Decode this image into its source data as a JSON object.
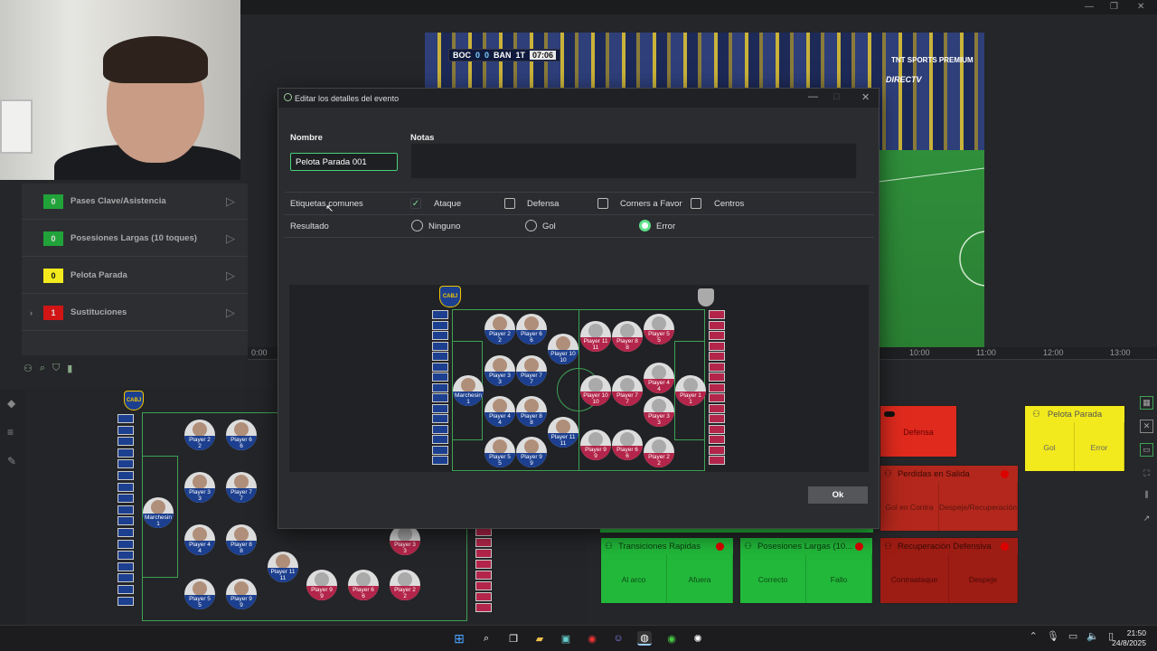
{
  "video": {
    "home_team": "BOC",
    "home_score": "0",
    "away_score": "0",
    "away_team": "BAN",
    "period": "1T",
    "clock": "07:06",
    "network": "TNT SPORTS PREMIUM",
    "sponsor": "DIRECTV"
  },
  "left_panel": {
    "rows": [
      {
        "count": "0",
        "label": "Pases Clave/Asistencia",
        "color": "#21a33a"
      },
      {
        "count": "0",
        "label": "Posesiones Largas (10 toques)",
        "color": "#21a33a"
      },
      {
        "count": "0",
        "label": "Pelota Parada",
        "color": "#f2ea1c"
      },
      {
        "count": "1",
        "label": "Sustituciones",
        "color": "#d11515"
      }
    ]
  },
  "timeline": {
    "labels": [
      "0:00",
      "10:00",
      "11:00",
      "12:00",
      "13:00"
    ]
  },
  "dialog": {
    "title": "Editar los detalles del evento",
    "name_label": "Nombre",
    "name_value": "Pelota Parada 001",
    "notes_label": "Notas",
    "tags_label": "Etiquetas comunes",
    "tags": [
      {
        "label": "Ataque",
        "checked": true
      },
      {
        "label": "Defensa",
        "checked": false
      },
      {
        "label": "Corners a Favor",
        "checked": false
      },
      {
        "label": "Centros",
        "checked": false
      }
    ],
    "result_label": "Resultado",
    "results": [
      {
        "label": "Ninguno",
        "selected": false
      },
      {
        "label": "Gol",
        "selected": false
      },
      {
        "label": "Error",
        "selected": true
      }
    ],
    "ok_label": "Ok"
  },
  "home_players": [
    {
      "name": "Player 2",
      "num": "2"
    },
    {
      "name": "Player 6",
      "num": "6"
    },
    {
      "name": "Player 10",
      "num": "10"
    },
    {
      "name": "Player 3",
      "num": "3"
    },
    {
      "name": "Player 7",
      "num": "7"
    },
    {
      "name": "Marchesin",
      "num": "1"
    },
    {
      "name": "Player 4",
      "num": "4"
    },
    {
      "name": "Player 8",
      "num": "8"
    },
    {
      "name": "Player 11",
      "num": "11"
    },
    {
      "name": "Player 5",
      "num": "5"
    },
    {
      "name": "Player 9",
      "num": "9"
    }
  ],
  "away_players": [
    {
      "name": "Player 11",
      "num": "11"
    },
    {
      "name": "Player 8",
      "num": "8"
    },
    {
      "name": "Player 5",
      "num": "5"
    },
    {
      "name": "Player 4",
      "num": "4"
    },
    {
      "name": "Player 10",
      "num": "10"
    },
    {
      "name": "Player 7",
      "num": "7"
    },
    {
      "name": "Player 1",
      "num": "1"
    },
    {
      "name": "Player 3",
      "num": "3"
    },
    {
      "name": "Player 9",
      "num": "9"
    },
    {
      "name": "Player 6",
      "num": "6"
    },
    {
      "name": "Player 2",
      "num": "2"
    }
  ],
  "crest_text": "CABJ",
  "tiles": {
    "defensa": {
      "label": "Defensa",
      "color": "#e02a1e"
    },
    "pelota_parada": {
      "title": "Pelota Parada",
      "b1": "Gol",
      "b2": "Error",
      "color": "#f2ea1c"
    },
    "perdidas": {
      "title": "Perdidas en Salida",
      "b1": "Gol en Contra",
      "b2": "Despeje/Recuperación",
      "color": "#b3271c"
    },
    "transiciones": {
      "title": "Transiciones Rapidas",
      "b1": "Al arco",
      "b2": "Afuera",
      "color": "#22b83a"
    },
    "posesiones": {
      "title": "Posesiones Largas (10...",
      "b1": "Correcto",
      "b2": "Fallo",
      "color": "#22b83a"
    },
    "recuperacion": {
      "title": "Recuperación Defensiva",
      "b1": "Contraataque",
      "b2": "Despeje",
      "color": "#9d1c14"
    }
  },
  "taskbar": {
    "time": "21:50",
    "date": "24/8/2025"
  }
}
